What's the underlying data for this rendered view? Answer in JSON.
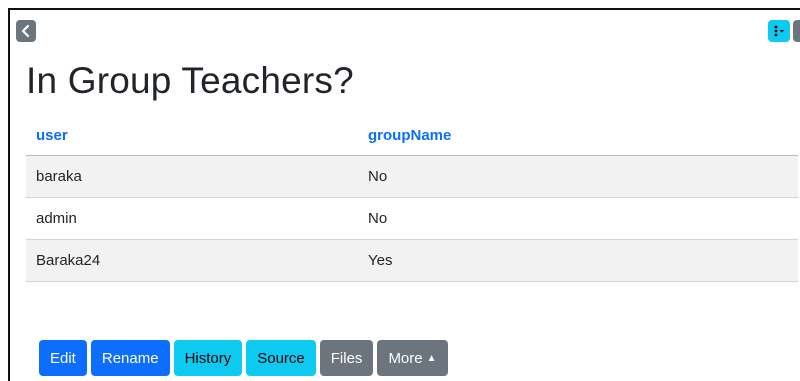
{
  "nav": {
    "back_icon": "chevron-left-icon",
    "menu_icon": "kebab-menu-icon",
    "next_icon": "chevron-right-icon"
  },
  "page": {
    "title": "In Group Teachers?"
  },
  "table": {
    "headers": [
      "user",
      "groupName"
    ],
    "rows": [
      [
        "baraka",
        "No"
      ],
      [
        "admin",
        "No"
      ],
      [
        "Baraka24",
        "Yes"
      ]
    ]
  },
  "toolbar": {
    "edit_label": "Edit",
    "rename_label": "Rename",
    "history_label": "History",
    "source_label": "Source",
    "files_label": "Files",
    "more_label": "More"
  },
  "colors": {
    "primary": "#0d6efd",
    "info": "#0dcaf0",
    "secondary": "#6c757d",
    "header_link": "#0d6efd"
  }
}
